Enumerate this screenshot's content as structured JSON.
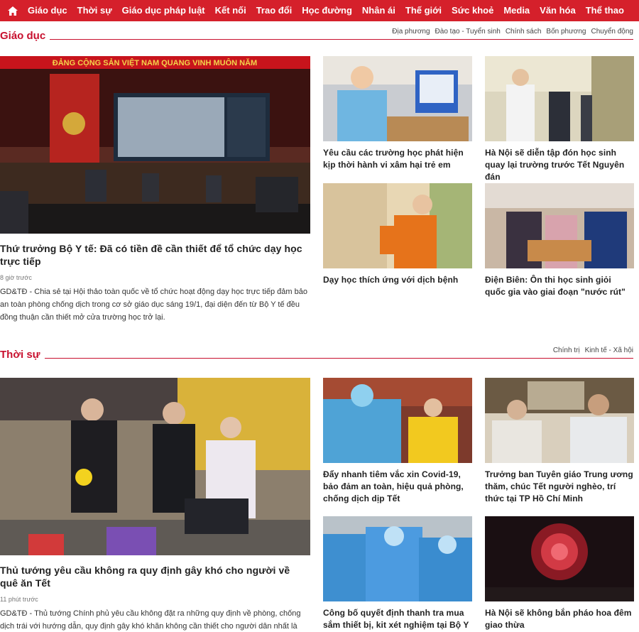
{
  "nav": {
    "items": [
      "Giáo dục",
      "Thời sự",
      "Giáo dục pháp luật",
      "Kết nối",
      "Trao đổi",
      "Học đường",
      "Nhân ái",
      "Thế giới",
      "Sức khoẻ",
      "Media",
      "Văn hóa",
      "Thể thao"
    ]
  },
  "giaoduc": {
    "title": "Giáo dục",
    "subcats": [
      "Địa phương",
      "Đào tạo - Tuyển sinh",
      "Chính sách",
      "Bốn phương",
      "Chuyển động"
    ],
    "main": {
      "banner": "ĐẢNG CỘNG SẢN VIỆT NAM QUANG VINH MUÔN NĂM",
      "title": "Thứ trưởng Bộ Y tế: Đã có tiền đề cần thiết để tổ chức dạy học trực tiếp",
      "time": "8 giờ trước",
      "desc": "GD&TĐ - Chia sẻ tại Hội thảo toàn quốc về tổ chức hoạt động dạy học trực tiếp đảm bảo an toàn phòng chống dịch trong cơ sở giáo dục sáng 19/1, đại diện đến từ Bộ Y tế đều đồng thuận cần thiết mở cửa trường học trở lại."
    },
    "cards": [
      {
        "title": "Yêu cầu các trường học phát hiện kịp thời hành vi xâm hại trẻ em"
      },
      {
        "title": "Hà Nội sẽ diễn tập đón học sinh quay lại trường trước Tết Nguyên đán"
      },
      {
        "title": "Dạy học thích ứng với dịch bệnh"
      },
      {
        "title": "Điện Biên: Ôn thi học sinh giỏi quốc gia vào giai đoạn \"nước rút\""
      }
    ]
  },
  "thoisu": {
    "title": "Thời sự",
    "subcats": [
      "Chính trị",
      "Kinh tế - Xã hội"
    ],
    "main": {
      "title": "Thủ tướng yêu cầu không ra quy định gây khó cho người về quê ăn Tết",
      "time": "11 phút trước",
      "desc": "GD&TĐ - Thủ tướng Chính phủ yêu cầu không đặt ra những quy định về phòng, chống dịch trái với hướng dẫn, quy định gây khó khăn không cần thiết cho người dân nhất là trong dịp về quê ăn Tết Nguyên đán."
    },
    "cards": [
      {
        "title": "Đẩy nhanh tiêm vắc xin Covid-19, bảo đảm an toàn, hiệu quả phòng, chống dịch dịp Tết"
      },
      {
        "title": "Trưởng ban Tuyên giáo Trung ương thăm, chúc Tết người nghèo, trí thức tại TP Hồ Chí Minh"
      },
      {
        "title": "Công bố quyết định thanh tra mua sắm thiết bị, kit xét nghiệm tại Bộ Y tế"
      },
      {
        "title": "Hà Nội sẽ không bắn pháo hoa đêm giao thừa"
      }
    ]
  },
  "colors": {
    "brand": "#d5202b",
    "accent": "#c8102e"
  }
}
